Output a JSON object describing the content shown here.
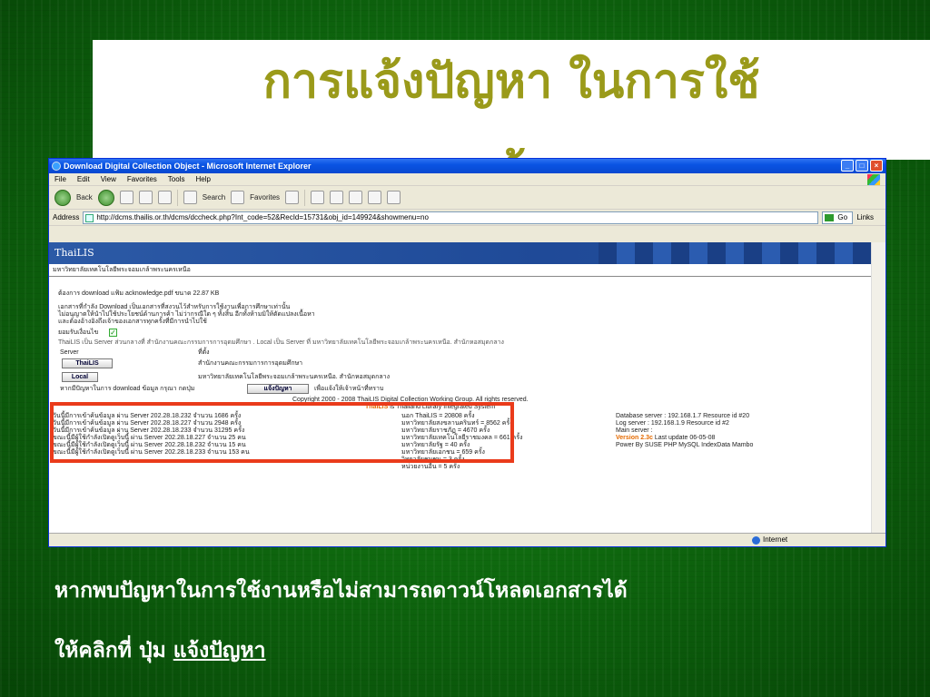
{
  "slide": {
    "title": "การแจ้งปัญหา ในการใช้\nฐานข้อมูล",
    "caption_line1": "หากพบปัญหาในการใช้งานหรือไม่สามารถดาวน์โหลดเอกสารได้",
    "caption_line2_prefix": "ให้คลิกที่ ปุ่ม",
    "caption_link": "แจ้งปัญหา"
  },
  "browser": {
    "window_title": "Download Digital Collection Object - Microsoft Internet Explorer",
    "menus": [
      "File",
      "Edit",
      "View",
      "Favorites",
      "Tools",
      "Help"
    ],
    "toolbar": {
      "back": "Back",
      "search": "Search",
      "favorites": "Favorites"
    },
    "address_label": "Address",
    "address_url": "http://dcms.thailis.or.th/dcms/dccheck.php?Int_code=52&RecId=15731&obj_id=149924&showmenu=no",
    "go_label": "Go",
    "links_label": "Links",
    "status_zone": "Internet"
  },
  "page": {
    "site_name": "ThaiLIS",
    "university": "มหาวิทยาลัยเทคโนโลยีพระจอมเกล้าพระนครเหนือ",
    "download_line": "ต้องการ download แฟ้ม acknowledge.pdf ขนาด 22.87 KB",
    "terms": "เอกสารที่กำลัง Download เป็นเอกสารที่สงวนไว้สำหรับการใช้งานเพื่อการศึกษาเท่านั้น\nไม่อนุญาตให้นำไปใช้ประโยชน์ด้านการค้า ไม่ว่ากรณีใด ๆ ทั้งสิ้น อีกทั้งห้ามมิให้ตัดแปลงเนื้อหา\nและต้องอ้างอิงถึงเจ้าของเอกสารทุกครั้งที่มีการนำไปใช้",
    "accept_label": "ยอมรับเงื่อนไข",
    "server_note": "ThaiLIS เป็น Server ส่วนกลางที่ สำนักงานคณะกรรมการการอุดมศึกษา . Local เป็น Server ที่ มหาวิทยาลัยเทคโนโลยีพระจอมเกล้าพระนครเหนือ. สำนักหอสมุดกลาง",
    "col_server": "Server",
    "col_location": "ที่ตั้ง",
    "btn_thailis": "ThaiLIS",
    "loc_thailis": "สำนักงานคณะกรรมการการอุดมศึกษา",
    "btn_local": "Local",
    "loc_local": "มหาวิทยาลัยเทคโนโลยีพระจอมเกล้าพระนครเหนือ. สำนักหอสมุดกลาง",
    "report_prefix": "หากมีปัญหาในการ download ข้อมูล กรุณา กดปุ่ม",
    "report_button": "แจ้งปัญหา",
    "report_suffix": "เพื่อแจ้งให้เจ้าหน้าที่ทราบ",
    "copyright": "Copyright 2000 - 2008 ThaiLIS Digital Collection Working Group. All rights reserved.",
    "footer_brand": "ThaiLIS",
    "footer_tagline": "is Thailand Library Integrated System",
    "stats_left": [
      "วันนี้มีการเข้าค้นข้อมูล ผ่าน Server 202.28.18.232 จำนวน 1686 ครั้ง",
      "วันนี้มีการเข้าค้นข้อมูล ผ่าน Server 202.28.18.227 จำนวน 2948 ครั้ง",
      "วันนี้มีการเข้าค้นข้อมูล ผ่าน Server 202.28.18.233 จำนวน 31295 ครั้ง",
      "ขณะนี้มีผู้ใช้กำลังเปิดดูเว็บนี้ ผ่าน Server 202.28.18.227 จำนวน 25 คน",
      "ขณะนี้มีผู้ใช้กำลังเปิดดูเว็บนี้ ผ่าน Server 202.28.18.232 จำนวน 15 คน",
      "ขณะนี้มีผู้ใช้กำลังเปิดดูเว็บนี้ ผ่าน Server 202.28.18.233 จำนวน 153 คน"
    ],
    "stats_mid": [
      "นอก ThaiLIS = 20808 ครั้ง",
      "มหาวิทยาลัยสงขลานครินทร์ = 8562 ครั้ง",
      "มหาวิทยาลัยราชภัฏ = 4670 ครั้ง",
      "มหาวิทยาลัยเทคโนโลยีราชมงคล = 661 ครั้ง",
      "มหาวิทยาลัยรัฐ = 40 ครั้ง",
      "มหาวิทยาลัยเอกชน = 659 ครั้ง",
      "วิทยาลัยชุมชน = 3 ครั้ง",
      "หน่วยงานอื่น = 5 ครั้ง"
    ],
    "stats_right": [
      "Database server : 192.168.1.7 Resource id #20",
      "Log server : 192.168.1.9 Resource id #2",
      "Main server :"
    ],
    "version_label": "Version 2.3c",
    "version_suffix": "Last update 06-05-08",
    "powered_by": "Power By SUSE PHP MySQL IndexData Mambo"
  }
}
